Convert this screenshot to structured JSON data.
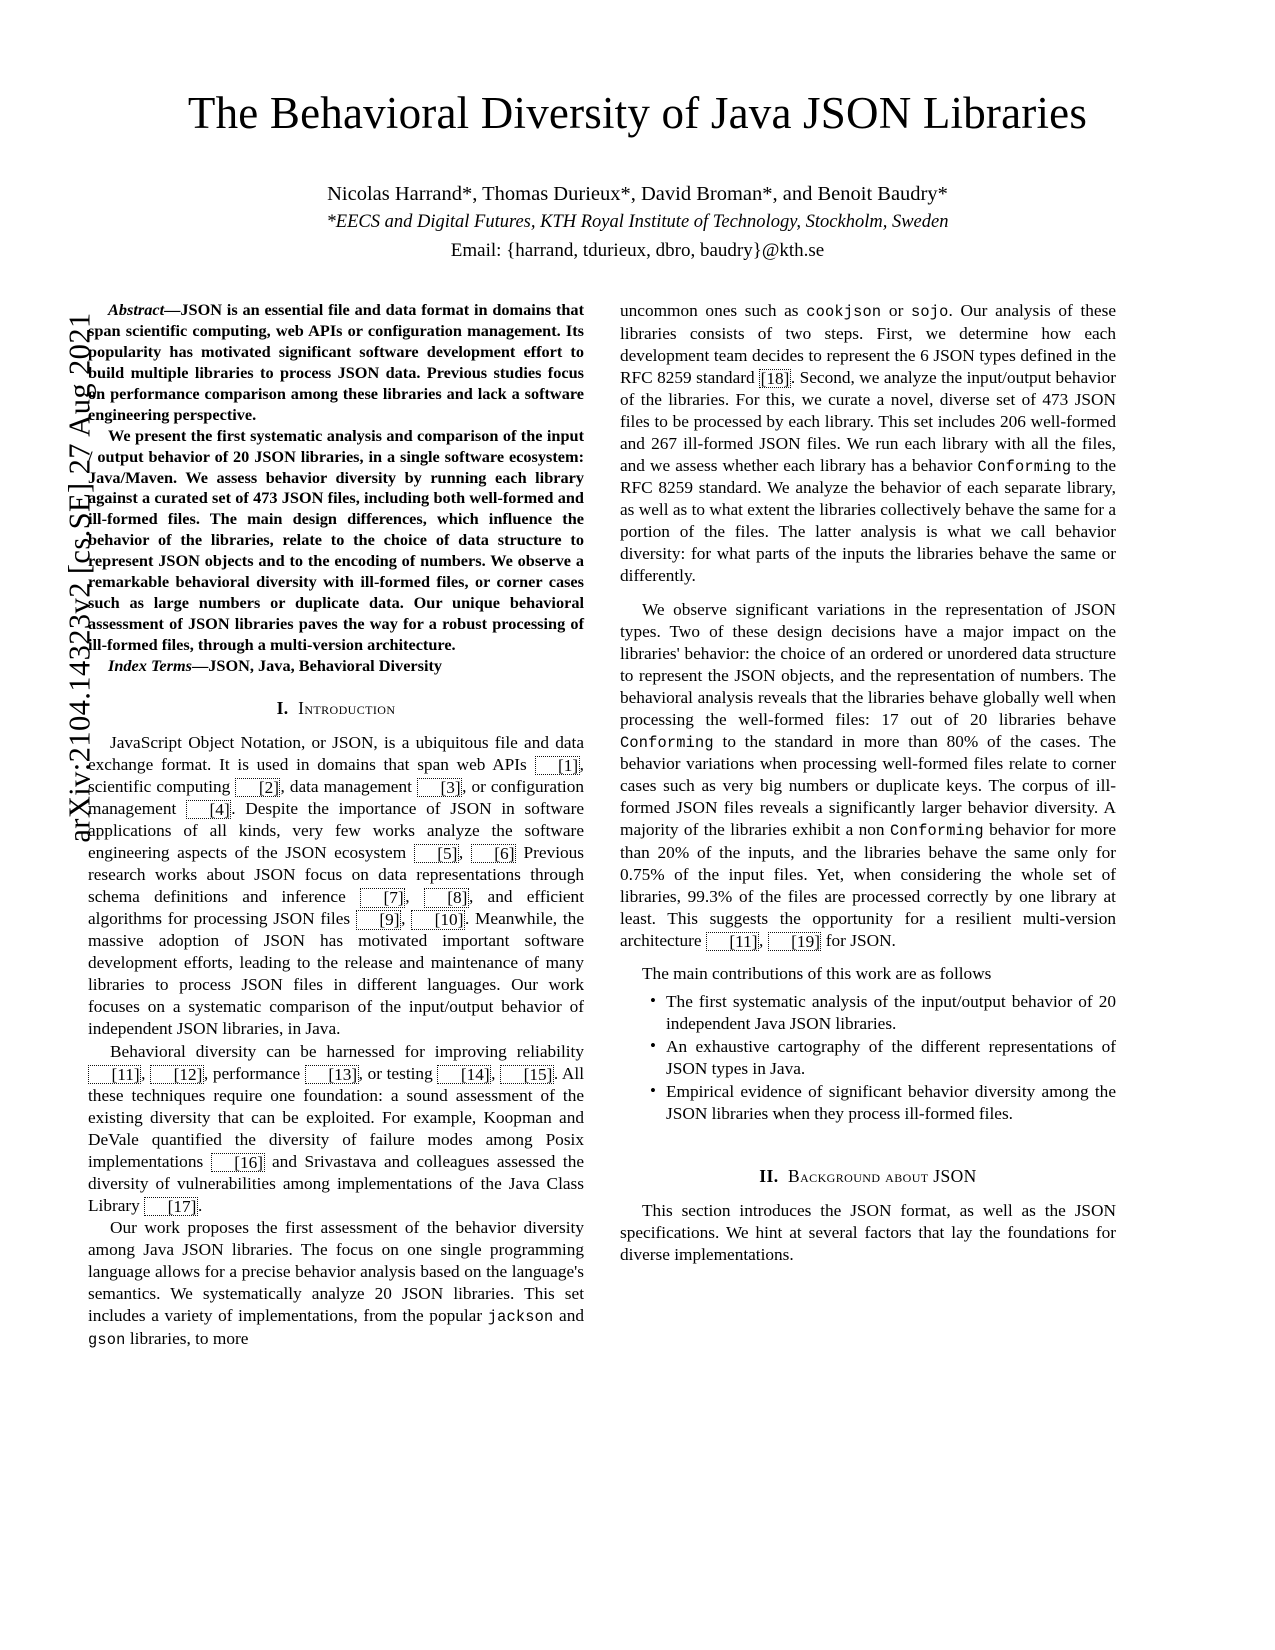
{
  "arxiv_stamp": "arXiv:2104.14323v2  [cs.SE]  27 Aug 2021",
  "title": "The Behavioral Diversity of Java JSON Libraries",
  "authors": "Nicolas Harrand*, Thomas Durieux*, David Broman*, and Benoit Baudry*",
  "affiliation": "*EECS and Digital Futures, KTH Royal Institute of Technology, Stockholm, Sweden",
  "email": "Email: {harrand, tdurieux, dbro, baudry}@kth.se",
  "abstract": {
    "lead_label": "Abstract",
    "dash": "—",
    "para1": "JSON is an essential file and data format in domains that span scientific computing, web APIs or configuration management. Its popularity has motivated significant software development effort to build multiple libraries to process JSON data. Previous studies focus on performance comparison among these libraries and lack a software engineering perspective.",
    "para2": "We present the first systematic analysis and comparison of the input / output behavior of 20 JSON libraries, in a single software ecosystem: Java/Maven. We assess behavior diversity by running each library against a curated set of 473 JSON files, including both well-formed and ill-formed files. The main design differences, which influence the behavior of the libraries, relate to the choice of data structure to represent JSON objects and to the encoding of numbers. We observe a remarkable behavioral diversity with ill-formed files, or corner cases such as large numbers or duplicate data. Our unique behavioral assessment of JSON libraries paves the way for a robust processing of ill-formed files, through a multi-version architecture.",
    "index_terms_label": "Index Terms",
    "index_terms": "JSON, Java, Behavioral Diversity"
  },
  "sections": {
    "intro": {
      "numeral": "I.",
      "title": "Introduction"
    },
    "background": {
      "numeral": "II.",
      "title": "Background about JSON"
    }
  },
  "intro": {
    "p1_a": "JavaScript Object Notation, or JSON, is a ubiquitous file and data exchange format. It is used in domains that span web APIs ",
    "p1_c1": "[1]",
    "p1_b": ", scientific computing ",
    "p1_c2": "[2]",
    "p1_c": ", data management ",
    "p1_c3": "[3]",
    "p1_d": ", or configuration management ",
    "p1_c4": "[4]",
    "p1_e": ". Despite the importance of JSON in software applications of all kinds, very few works analyze the software engineering aspects of the JSON ecosystem ",
    "p1_c5": "[5]",
    "p1_f": ", ",
    "p1_c6": "[6]",
    "p1_g": " Previous research works about JSON focus on data representations through schema definitions and inference ",
    "p1_c7": "[7]",
    "p1_h": ", ",
    "p1_c8": "[8]",
    "p1_i": ", and efficient algorithms for processing JSON files ",
    "p1_c9": "[9]",
    "p1_j": ", ",
    "p1_c10": "[10]",
    "p1_k": ". Meanwhile, the massive adoption of JSON has motivated important software development efforts, leading to the release and maintenance of many libraries to process JSON files in different languages. Our work focuses on a systematic comparison of the input/output behavior of independent JSON libraries, in Java.",
    "p2_a": "Behavioral diversity can be harnessed for improving reliability ",
    "p2_c11": "[11]",
    "p2_b": ", ",
    "p2_c12": "[12]",
    "p2_c": ", performance ",
    "p2_c13": "[13]",
    "p2_d": ", or testing ",
    "p2_c14": "[14]",
    "p2_e": ", ",
    "p2_c15": "[15]",
    "p2_f": ". All these techniques require one foundation: a sound assessment of the existing diversity that can be exploited. For example, Koopman and DeVale quantified the diversity of failure modes among Posix implementations ",
    "p2_c16": "[16]",
    "p2_g": " and Srivastava and colleagues assessed the diversity of vulnerabilities among implementations of the Java Class Library ",
    "p2_c17": "[17]",
    "p2_h": ".",
    "p3_a": "Our work proposes the first assessment of the behavior diversity among Java JSON libraries. The focus on one single programming language allows for a precise behavior analysis based on the language's semantics. We systematically analyze 20 JSON libraries. This set includes a variety of implementations, from the popular ",
    "p3_m1": "jackson",
    "p3_b": " and ",
    "p3_m2": "gson",
    "p3_c": " libraries, to more"
  },
  "right": {
    "p3_cont_a": "uncommon ones such as ",
    "p3_m3": "cookjson",
    "p3_cont_b": " or ",
    "p3_m4": "sojo",
    "p3_cont_c": ". Our analysis of these libraries consists of two steps. First, we determine how each development team decides to represent the 6 JSON types defined in the RFC 8259 standard ",
    "p3_c18": "[18]",
    "p3_cont_d": ". Second, we analyze the input/output behavior of the libraries. For this, we curate a novel, diverse set of 473 JSON files to be processed by each library. This set includes 206 well-formed and 267 ill-formed JSON files. We run each library with all the files, and we assess whether each library has a behavior ",
    "p3_m5": "Conforming",
    "p3_cont_e": " to the RFC 8259 standard. We analyze the behavior of each separate library, as well as to what extent the libraries collectively behave the same for a portion of the files. The latter analysis is what we call behavior diversity: for what parts of the inputs the libraries behave the same or differently.",
    "p4_a": "We observe significant variations in the representation of JSON types. Two of these design decisions have a major impact on the libraries' behavior: the choice of an ordered or unordered data structure to represent the JSON objects, and the representation of numbers. The behavioral analysis reveals that the libraries behave globally well when processing the well-formed files: 17 out of 20 libraries behave ",
    "p4_m1": "Conforming",
    "p4_b": " to the standard in more than 80% of the cases. The behavior variations when processing well-formed files relate to corner cases such as very big numbers or duplicate keys. The corpus of ill-formed JSON files reveals a significantly larger behavior diversity. A majority of the libraries exhibit a non ",
    "p4_m2": "Conforming",
    "p4_c": " behavior for more than 20% of the inputs, and the libraries behave the same only for 0.75% of the input files. Yet, when considering the whole set of libraries, 99.3% of the files are processed correctly by one library at least. This suggests the opportunity for a resilient multi-version architecture ",
    "p4_c11": "[11]",
    "p4_d": ", ",
    "p4_c19": "[19]",
    "p4_e": " for JSON.",
    "contrib_intro": "The main contributions of this work are as follows",
    "contributions": [
      "The first systematic analysis of the input/output behavior of 20 independent Java JSON libraries.",
      "An exhaustive cartography of the different representations of JSON types in Java.",
      "Empirical evidence of significant behavior diversity among the JSON libraries when they process ill-formed files."
    ],
    "background_p1": "This section introduces the JSON format, as well as the JSON specifications. We hint at several factors that lay the foundations for diverse implementations."
  }
}
